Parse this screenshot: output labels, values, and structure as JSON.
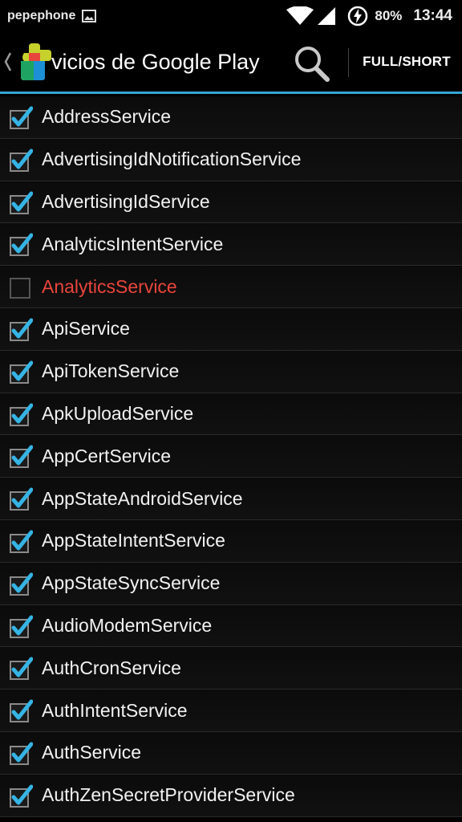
{
  "status_bar": {
    "carrier": "pepephone",
    "battery": "80%",
    "time": "13:44"
  },
  "action_bar": {
    "title": "Servicios de Google Play",
    "toggle_label": "FULL/SHORT",
    "icons": [
      "up-caret-icon",
      "google-play-services-icon",
      "search-icon"
    ]
  },
  "colors": {
    "accent": "#35a7d7",
    "disabled_text": "#e8453c",
    "check": "#35b4e5"
  },
  "services": [
    {
      "name": "AddressService",
      "enabled": true
    },
    {
      "name": "AdvertisingIdNotificationService",
      "enabled": true
    },
    {
      "name": "AdvertisingIdService",
      "enabled": true
    },
    {
      "name": "AnalyticsIntentService",
      "enabled": true
    },
    {
      "name": "AnalyticsService",
      "enabled": false
    },
    {
      "name": "ApiService",
      "enabled": true
    },
    {
      "name": "ApiTokenService",
      "enabled": true
    },
    {
      "name": "ApkUploadService",
      "enabled": true
    },
    {
      "name": "AppCertService",
      "enabled": true
    },
    {
      "name": "AppStateAndroidService",
      "enabled": true
    },
    {
      "name": "AppStateIntentService",
      "enabled": true
    },
    {
      "name": "AppStateSyncService",
      "enabled": true
    },
    {
      "name": "AudioModemService",
      "enabled": true
    },
    {
      "name": "AuthCronService",
      "enabled": true
    },
    {
      "name": "AuthIntentService",
      "enabled": true
    },
    {
      "name": "AuthService",
      "enabled": true
    },
    {
      "name": "AuthZenSecretProviderService",
      "enabled": true
    }
  ]
}
